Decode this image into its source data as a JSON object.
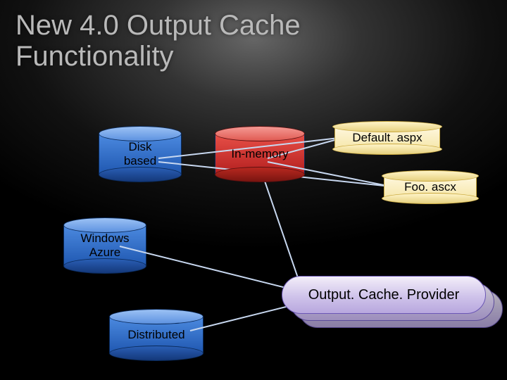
{
  "title_line1": "New 4.0 Output Cache",
  "title_line2": "Functionality",
  "cylinders": {
    "disk": {
      "label": "Disk\nbased"
    },
    "inmemory": {
      "label": "In-memory"
    },
    "azure": {
      "label": "Windows\nAzure"
    },
    "distributed": {
      "label": "Distributed"
    }
  },
  "scrolls": {
    "default": {
      "label": "Default. aspx"
    },
    "foo": {
      "label": "Foo. ascx"
    }
  },
  "provider": {
    "label": "Output. Cache. Provider"
  },
  "colors": {
    "blue_light": "#4c8ae0",
    "blue_dark": "#1f57b0",
    "red_light": "#e85048",
    "red_dark": "#b31f1f",
    "scroll_top": "#fff8e0",
    "scroll_bot": "#f5e6a8",
    "pill_top": "#f3eef9",
    "pill_bot": "#b8a7de"
  },
  "chart_data": {
    "type": "diagram",
    "title": "New 4.0 Output Cache Functionality",
    "nodes": [
      {
        "id": "disk",
        "kind": "cylinder",
        "color": "blue",
        "label": "Disk based"
      },
      {
        "id": "inmemory",
        "kind": "cylinder",
        "color": "red",
        "label": "In-memory"
      },
      {
        "id": "azure",
        "kind": "cylinder",
        "color": "blue",
        "label": "Windows Azure"
      },
      {
        "id": "distributed",
        "kind": "cylinder",
        "color": "blue",
        "label": "Distributed"
      },
      {
        "id": "default",
        "kind": "scroll",
        "label": "Default. aspx"
      },
      {
        "id": "foo",
        "kind": "scroll",
        "label": "Foo. ascx"
      },
      {
        "id": "provider",
        "kind": "pill-stack",
        "label": "Output. Cache. Provider"
      }
    ],
    "edges": [
      {
        "from": "disk",
        "to": "default"
      },
      {
        "from": "inmemory",
        "to": "default"
      },
      {
        "from": "disk",
        "to": "foo"
      },
      {
        "from": "inmemory",
        "to": "foo"
      },
      {
        "from": "azure",
        "to": "provider"
      },
      {
        "from": "inmemory",
        "to": "provider"
      },
      {
        "from": "distributed",
        "to": "provider"
      }
    ]
  }
}
